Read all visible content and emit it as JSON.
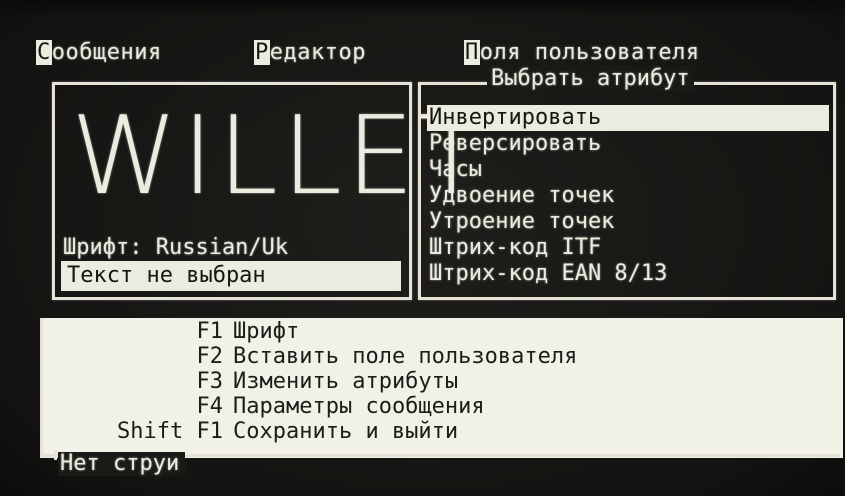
{
  "menubar": {
    "items": [
      {
        "hotkey": "С",
        "rest": "ообщения"
      },
      {
        "hotkey": "Р",
        "rest": "едактор"
      },
      {
        "hotkey": "П",
        "rest": "оля пользователя"
      }
    ]
  },
  "preview": {
    "brand_text": "WILLET",
    "font_line": "Шрифт: Russian/Uk",
    "text_status": "Текст не выбран"
  },
  "attributes": {
    "title": "Выбрать атрибут",
    "selected_index": 0,
    "items": [
      {
        "hotkey": "И",
        "rest": "нвертировать"
      },
      {
        "hotkey": "",
        "rest": "Реверсировать"
      },
      {
        "hotkey": "",
        "rest": "Часы"
      },
      {
        "hotkey": "",
        "rest": "Удвоение точек"
      },
      {
        "hotkey": "",
        "rest": "Утроение точек"
      },
      {
        "hotkey": "",
        "rest": "Штрих-код ITF"
      },
      {
        "hotkey": "",
        "rest": "Штрих-код EAN 8/13"
      }
    ]
  },
  "help": {
    "rows": [
      {
        "key": "F1",
        "text": "Шрифт"
      },
      {
        "key": "F2",
        "text": "Вставить поле пользователя"
      },
      {
        "key": "F3",
        "text": "Изменить атрибуты"
      },
      {
        "key": "F4",
        "text": "Параметры сообщения"
      },
      {
        "key": "Shift F1",
        "text": "Сохранить и выйти"
      }
    ]
  },
  "status": {
    "text": "Нет струи"
  }
}
